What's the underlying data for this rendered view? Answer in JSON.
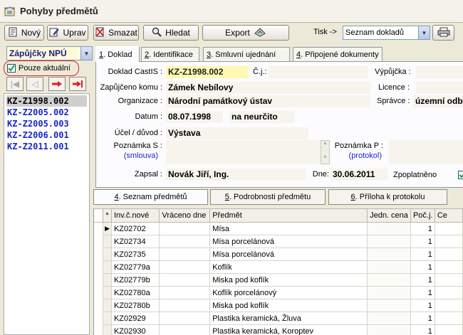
{
  "window": {
    "title": "Pohyby předmětů"
  },
  "toolbar": {
    "new_label": "Nový",
    "edit_label": "Uprav",
    "delete_label": "Smazat",
    "search_label": "Hledat",
    "export_label": "Export",
    "print_label": "Tisk ->",
    "print_select_value": "Seznam dokladů"
  },
  "left": {
    "type_select_value": "Zápůjčky NPÚ",
    "only_current_label": "Pouze aktuální",
    "only_current_checked": true,
    "records": [
      "KZ-Z1998.002",
      "KZ-Z2005.002",
      "KZ-Z2005.003",
      "KZ-Z2006.001",
      "KZ-Z2011.001"
    ]
  },
  "tabs": [
    {
      "num": "1",
      "label": ". Doklad"
    },
    {
      "num": "2",
      "label": ". Identifikace"
    },
    {
      "num": "3",
      "label": ". Smluvní ujednání"
    },
    {
      "num": "4",
      "label": ". Připojené dokumenty"
    }
  ],
  "form": {
    "doc_label": "Doklad CastIS :",
    "doc_value": "KZ-Z1998.002",
    "cj_label": "Č.j.:",
    "vypujcka_label": "Výpůjčka :",
    "zapujceno_label": "Zapůjčeno komu :",
    "zapujceno_value": "Zámek Nebílovy",
    "licence_label": "Licence :",
    "organizace_label": "Organizace :",
    "organizace_value": "Národní památkový ústav",
    "spravce_label": "Správce :",
    "spravce_value": "územní odbo",
    "datum_label": "Datum :",
    "datum_value": "08.07.1998",
    "neurcito_value": "na neurčito",
    "ucel_label": "Účel / důvod :",
    "ucel_value": "Výstava",
    "poznamka_s_label": "Poznámka S :",
    "poznamka_s_sub": "(smlouva)",
    "poznamka_p_label": "Poznámka P :",
    "poznamka_p_sub": "(protokol)",
    "zapsal_label": "Zapsal :",
    "zapsal_value": "Novák Jiří, Ing.",
    "dne_label": "Dne:",
    "dne_value": "30.06.2011",
    "zpoplatneno_label": "Zpoplatněno"
  },
  "subtabs": [
    {
      "num": "4",
      "label": ". Seznam předmětů"
    },
    {
      "num": "5",
      "label": ". Podrobnosti předmětu"
    },
    {
      "num": "6",
      "label": ". Příloha k protokolu"
    }
  ],
  "grid": {
    "headers": [
      "*",
      "Inv.č.nové",
      "Vráceno dne",
      "Předmět",
      "Jedn. cena",
      "Poč.j.",
      "Ce"
    ],
    "rows": [
      [
        "KZ02702",
        "",
        "Mísa",
        "",
        "1"
      ],
      [
        "KZ02734",
        "",
        "Mísa porcelánová",
        "",
        "1"
      ],
      [
        "KZ02735",
        "",
        "Mísa porcelánová",
        "",
        "1"
      ],
      [
        "KZ02779a",
        "",
        "Koflík",
        "",
        "1"
      ],
      [
        "KZ02779b",
        "",
        "Miska pod koflík",
        "",
        "1"
      ],
      [
        "KZ02780a",
        "",
        "Koflík porcelánový",
        "",
        "1"
      ],
      [
        "KZ02780b",
        "",
        "Miska pod koflík",
        "",
        "1"
      ],
      [
        "KZ02929",
        "",
        "Plastika keramická, Žluva",
        "",
        "1"
      ],
      [
        "KZ02930",
        "",
        "Plastika keramická, Koroptev",
        "",
        "1"
      ]
    ]
  },
  "colors": {
    "record_link": "#1a27c8",
    "selected_record_bg": "#cfcfcf",
    "value_bg": "#f6f4ec",
    "check_highlight": "#d9232d"
  }
}
